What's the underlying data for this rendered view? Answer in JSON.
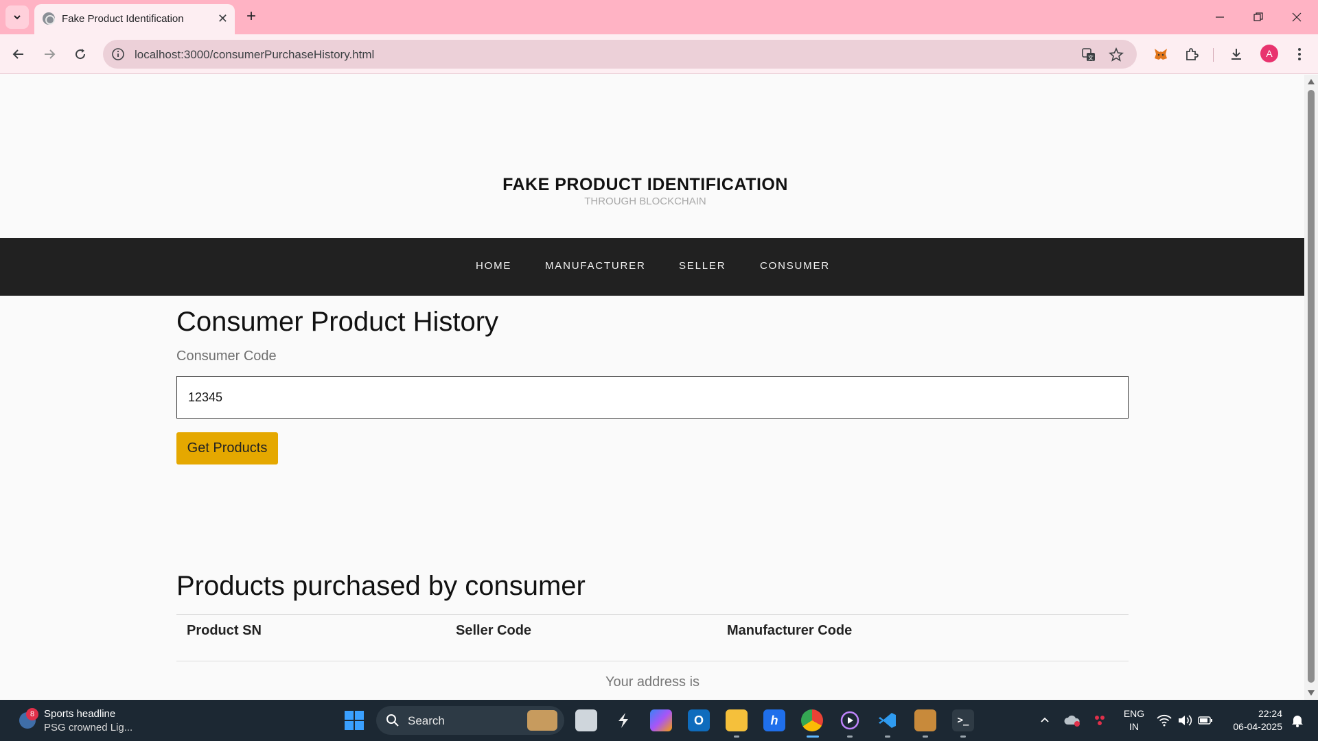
{
  "browser": {
    "tab_title": "Fake Product Identification",
    "url": "localhost:3000/consumerPurchaseHistory.html",
    "profile_initial": "A"
  },
  "site": {
    "title": "FAKE PRODUCT IDENTIFICATION",
    "subtitle": "THROUGH BLOCKCHAIN",
    "nav": [
      "HOME",
      "MANUFACTURER",
      "SELLER",
      "CONSUMER"
    ]
  },
  "form": {
    "heading": "Consumer Product History",
    "code_label": "Consumer Code",
    "code_value": "12345",
    "button_label": "Get Products"
  },
  "products": {
    "heading": "Products purchased by consumer",
    "columns": [
      "Product SN",
      "Seller Code",
      "Manufacturer Code"
    ],
    "address_text": "Your address is"
  },
  "taskbar": {
    "news_title": "Sports headline",
    "news_sub": "PSG crowned Lig...",
    "news_badge": "8",
    "search_label": "Search",
    "lang_line1": "ENG",
    "lang_line2": "IN",
    "time": "22:24",
    "date": "06-04-2025"
  },
  "colors": {
    "tab_strip": "#ffb3c4",
    "nav_bar": "#212121",
    "accent_button": "#e5a800"
  }
}
